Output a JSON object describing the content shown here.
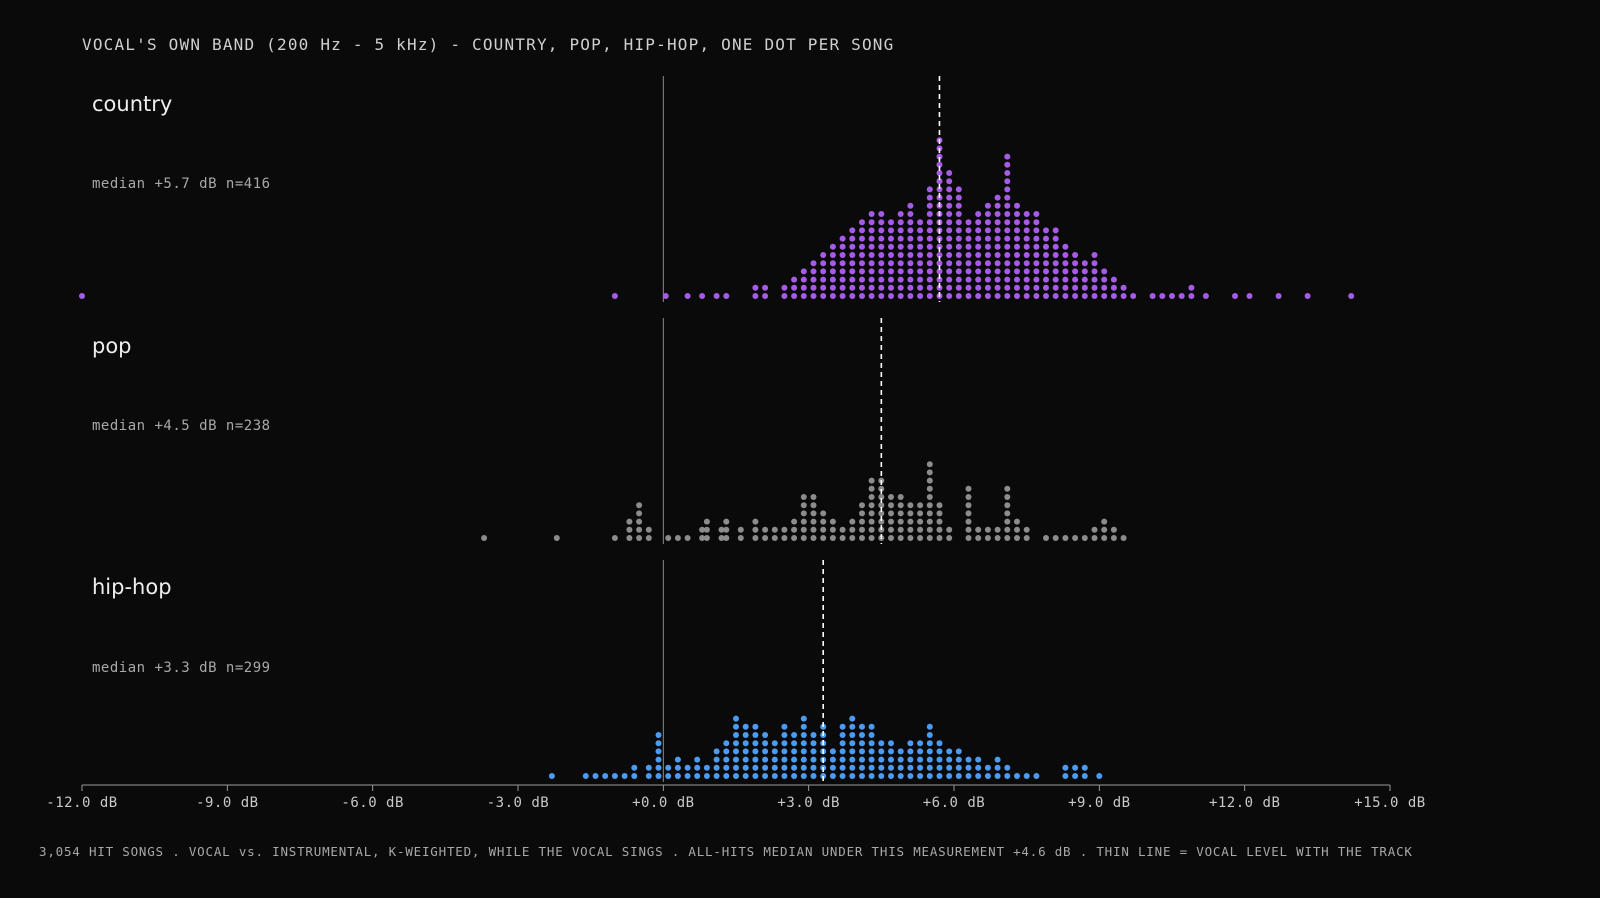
{
  "chart_data": {
    "type": "scatter",
    "subtype": "dot-histogram",
    "title": "VOCAL'S OWN BAND (200 Hz - 5 kHz) - COUNTRY, POP, HIP-HOP, ONE DOT PER SONG",
    "footer": "3,054 HIT SONGS . VOCAL vs. INSTRUMENTAL, K-WEIGHTED, WHILE THE VOCAL SINGS . ALL-HITS MEDIAN UNDER THIS MEASUREMENT +4.6 dB . THIN LINE = VOCAL LEVEL WITH THE TRACK",
    "xlim": [
      -12,
      15
    ],
    "xticks": [
      -12,
      -9,
      -6,
      -3,
      0,
      3,
      6,
      9,
      12,
      15
    ],
    "xtick_labels": [
      "-12.0 dB",
      "-9.0 dB",
      "-6.0 dB",
      "-3.0 dB",
      "+0.0 dB",
      "+3.0 dB",
      "+6.0 dB",
      "+9.0 dB",
      "+12.0 dB",
      "+15.0 dB"
    ],
    "reference_line_x": 0,
    "bin_width_db": 0.3,
    "series": [
      {
        "name": "country",
        "stats": "median +5.7 dB  n=416",
        "median": 5.7,
        "n": 416,
        "color": "#a65be6",
        "bins": [
          [
            -12.0,
            1
          ],
          [
            -1.0,
            1
          ],
          [
            0.05,
            1
          ],
          [
            0.5,
            1
          ],
          [
            0.8,
            1
          ],
          [
            1.1,
            1
          ],
          [
            1.3,
            1
          ],
          [
            1.9,
            2
          ],
          [
            2.1,
            2
          ],
          [
            2.5,
            2
          ],
          [
            2.7,
            3
          ],
          [
            2.9,
            4
          ],
          [
            3.1,
            5
          ],
          [
            3.3,
            6
          ],
          [
            3.5,
            7
          ],
          [
            3.7,
            8
          ],
          [
            3.9,
            9
          ],
          [
            4.1,
            10
          ],
          [
            4.3,
            11
          ],
          [
            4.5,
            11
          ],
          [
            4.7,
            10
          ],
          [
            4.9,
            11
          ],
          [
            5.1,
            12
          ],
          [
            5.3,
            10
          ],
          [
            5.5,
            14
          ],
          [
            5.7,
            20
          ],
          [
            5.9,
            16
          ],
          [
            6.1,
            14
          ],
          [
            6.3,
            10
          ],
          [
            6.5,
            11
          ],
          [
            6.7,
            12
          ],
          [
            6.9,
            13
          ],
          [
            7.1,
            18
          ],
          [
            7.3,
            12
          ],
          [
            7.5,
            11
          ],
          [
            7.7,
            11
          ],
          [
            7.9,
            9
          ],
          [
            8.1,
            9
          ],
          [
            8.3,
            7
          ],
          [
            8.5,
            6
          ],
          [
            8.7,
            5
          ],
          [
            8.9,
            6
          ],
          [
            9.1,
            4
          ],
          [
            9.3,
            3
          ],
          [
            9.5,
            2
          ],
          [
            9.7,
            1
          ],
          [
            10.1,
            1
          ],
          [
            10.3,
            1
          ],
          [
            10.5,
            1
          ],
          [
            10.7,
            1
          ],
          [
            10.9,
            2
          ],
          [
            11.2,
            1
          ],
          [
            11.8,
            1
          ],
          [
            12.1,
            1
          ],
          [
            12.7,
            1
          ],
          [
            13.3,
            1
          ],
          [
            14.2,
            1
          ]
        ]
      },
      {
        "name": "pop",
        "stats": "median +4.5 dB  n=238",
        "median": 4.5,
        "n": 238,
        "color": "#8c8c8c",
        "bins": [
          [
            -3.7,
            1
          ],
          [
            -2.2,
            1
          ],
          [
            -1.0,
            1
          ],
          [
            -0.7,
            3
          ],
          [
            -0.5,
            5
          ],
          [
            -0.3,
            2
          ],
          [
            0.1,
            1
          ],
          [
            0.3,
            1
          ],
          [
            0.5,
            1
          ],
          [
            0.8,
            2
          ],
          [
            0.9,
            3
          ],
          [
            1.2,
            2
          ],
          [
            1.3,
            3
          ],
          [
            1.6,
            2
          ],
          [
            1.9,
            3
          ],
          [
            2.1,
            2
          ],
          [
            2.3,
            2
          ],
          [
            2.5,
            2
          ],
          [
            2.7,
            3
          ],
          [
            2.9,
            6
          ],
          [
            3.1,
            6
          ],
          [
            3.3,
            4
          ],
          [
            3.5,
            3
          ],
          [
            3.7,
            2
          ],
          [
            3.9,
            3
          ],
          [
            4.1,
            5
          ],
          [
            4.3,
            8
          ],
          [
            4.5,
            8
          ],
          [
            4.7,
            6
          ],
          [
            4.9,
            6
          ],
          [
            5.1,
            5
          ],
          [
            5.3,
            5
          ],
          [
            5.5,
            10
          ],
          [
            5.7,
            5
          ],
          [
            5.9,
            2
          ],
          [
            6.3,
            7
          ],
          [
            6.5,
            2
          ],
          [
            6.7,
            2
          ],
          [
            6.9,
            2
          ],
          [
            7.1,
            7
          ],
          [
            7.3,
            3
          ],
          [
            7.5,
            2
          ],
          [
            7.9,
            1
          ],
          [
            8.1,
            1
          ],
          [
            8.3,
            1
          ],
          [
            8.5,
            1
          ],
          [
            8.7,
            1
          ],
          [
            8.9,
            2
          ],
          [
            9.1,
            3
          ],
          [
            9.3,
            2
          ],
          [
            9.5,
            1
          ]
        ]
      },
      {
        "name": "hip-hop",
        "stats": "median +3.3 dB  n=299",
        "median": 3.3,
        "n": 299,
        "color": "#4d9bf0",
        "bins": [
          [
            -2.3,
            1
          ],
          [
            -1.6,
            1
          ],
          [
            -1.4,
            1
          ],
          [
            -1.2,
            1
          ],
          [
            -1.0,
            1
          ],
          [
            -0.8,
            1
          ],
          [
            -0.6,
            2
          ],
          [
            -0.3,
            2
          ],
          [
            -0.1,
            6
          ],
          [
            0.1,
            2
          ],
          [
            0.3,
            3
          ],
          [
            0.5,
            2
          ],
          [
            0.7,
            3
          ],
          [
            0.9,
            2
          ],
          [
            1.1,
            4
          ],
          [
            1.3,
            5
          ],
          [
            1.5,
            8
          ],
          [
            1.7,
            7
          ],
          [
            1.9,
            7
          ],
          [
            2.1,
            6
          ],
          [
            2.3,
            5
          ],
          [
            2.5,
            7
          ],
          [
            2.7,
            6
          ],
          [
            2.9,
            8
          ],
          [
            3.1,
            6
          ],
          [
            3.3,
            7
          ],
          [
            3.5,
            4
          ],
          [
            3.7,
            7
          ],
          [
            3.9,
            8
          ],
          [
            4.1,
            7
          ],
          [
            4.3,
            7
          ],
          [
            4.5,
            5
          ],
          [
            4.7,
            5
          ],
          [
            4.9,
            4
          ],
          [
            5.1,
            5
          ],
          [
            5.3,
            5
          ],
          [
            5.5,
            7
          ],
          [
            5.7,
            5
          ],
          [
            5.9,
            4
          ],
          [
            6.1,
            4
          ],
          [
            6.3,
            3
          ],
          [
            6.5,
            3
          ],
          [
            6.7,
            2
          ],
          [
            6.9,
            3
          ],
          [
            7.1,
            2
          ],
          [
            7.3,
            1
          ],
          [
            7.5,
            1
          ],
          [
            7.7,
            1
          ],
          [
            8.3,
            2
          ],
          [
            8.5,
            2
          ],
          [
            8.7,
            2
          ],
          [
            9.0,
            1
          ]
        ]
      }
    ]
  }
}
